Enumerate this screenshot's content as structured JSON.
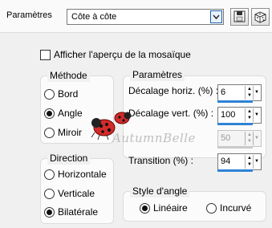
{
  "topbar": {
    "label": "Paramètres",
    "preset_value": "Côte à côte",
    "icons": [
      "save-preset-icon",
      "random-preset-icon"
    ]
  },
  "preview_checkbox": {
    "label": "Afficher l'aperçu de la mosaïque",
    "checked": false
  },
  "methode": {
    "title": "Méthode",
    "options": [
      "Bord",
      "Angle",
      "Miroir"
    ],
    "selected": "Angle"
  },
  "direction": {
    "title": "Direction",
    "options": [
      "Horizontale",
      "Verticale",
      "Bilatérale"
    ],
    "selected": "Bilatérale"
  },
  "parametres": {
    "title": "Paramètres",
    "decalage_horiz": {
      "label": "Décalage horiz. (%) :",
      "value": "6"
    },
    "decalage_vert": {
      "label": "Décalage vert. (%) :",
      "value": "100"
    },
    "angle_value": {
      "value": "50",
      "disabled": true
    },
    "transition": {
      "label": "Transition (%) :",
      "value": "94"
    }
  },
  "style_angle": {
    "title": "Style d'angle",
    "options": [
      "Linéaire",
      "Incurvé"
    ],
    "selected": "Linéaire"
  },
  "watermark": {
    "text": "AutumnBelle",
    "icon": "ladybug-icon"
  },
  "colors": {
    "accent": "#2f82d6",
    "background": "#f0f0f0"
  }
}
